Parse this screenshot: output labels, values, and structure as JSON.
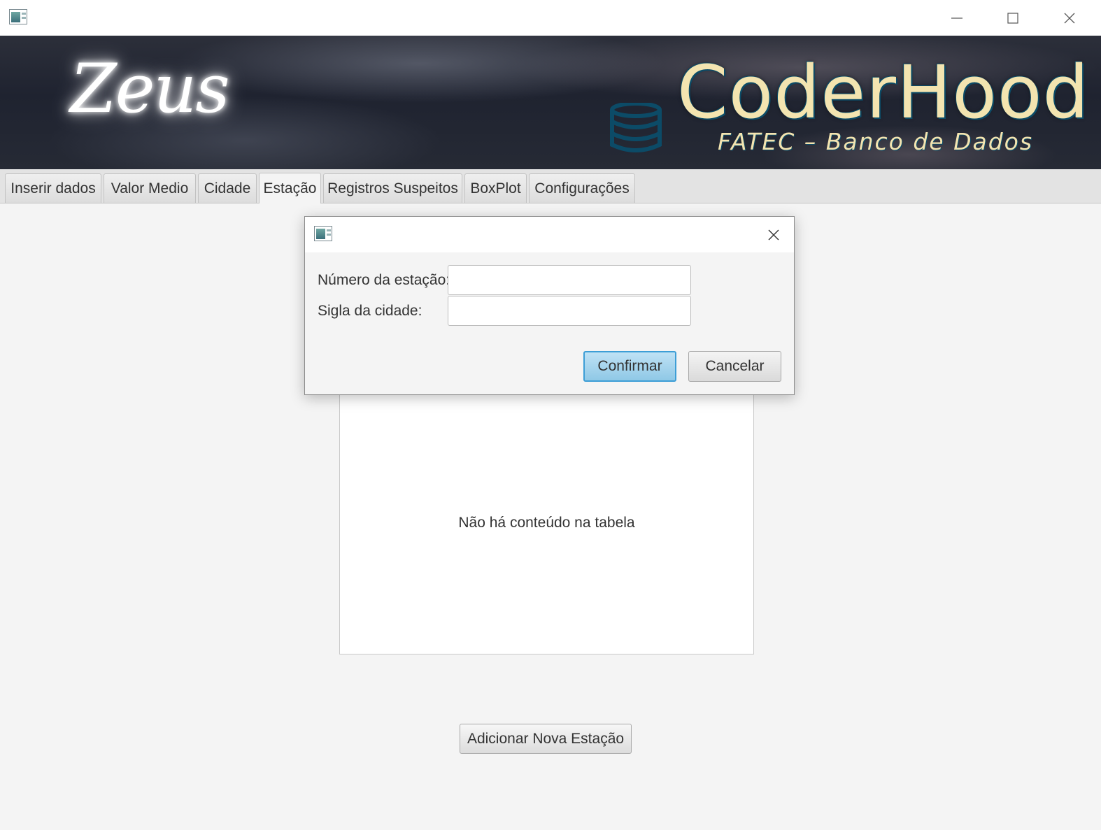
{
  "window": {
    "minimize_glyph": "─",
    "maximize_glyph": "☐",
    "close_glyph": "✕"
  },
  "banner": {
    "logo_left": "Zeus",
    "logo_right": "CoderHood",
    "subtitle": "FATEC – Banco de Dados",
    "icons": {
      "database": "database-icon"
    },
    "colors": {
      "brand_text": "#f3e4b0",
      "brand_outline": "#0c4b67"
    }
  },
  "tabs": [
    {
      "label": "Inserir dados"
    },
    {
      "label": "Valor Medio"
    },
    {
      "label": "Cidade"
    },
    {
      "label": "Estação",
      "active": true
    },
    {
      "label": "Registros Suspeitos"
    },
    {
      "label": "BoxPlot"
    },
    {
      "label": "Configurações"
    }
  ],
  "table": {
    "empty_message": "Não há conteúdo na tabela"
  },
  "main": {
    "add_button_label": "Adicionar Nova Estação"
  },
  "dialog": {
    "station_number_label": "Número da estação:",
    "station_number_value": "",
    "city_code_label": "Sigla da cidade:",
    "city_code_value": "",
    "confirm_label": "Confirmar",
    "cancel_label": "Cancelar",
    "accent_color": "#3d9ed6"
  }
}
